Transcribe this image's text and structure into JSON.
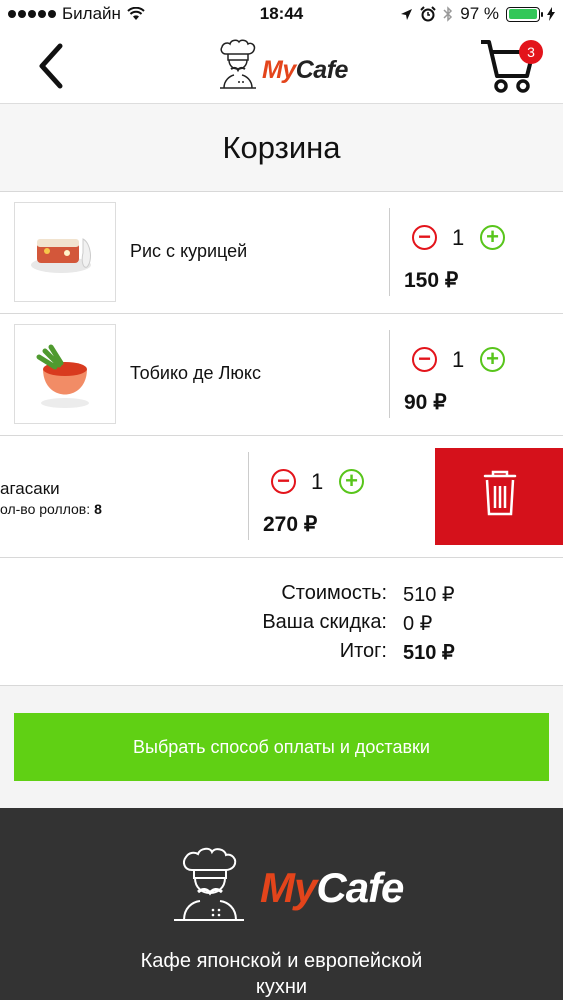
{
  "status_bar": {
    "carrier": "Билайн",
    "time": "18:44",
    "battery_percent": "97 %",
    "battery_level": 0.97
  },
  "header": {
    "logo_text": "MyCafe",
    "cart_count": "3"
  },
  "page_title": "Корзина",
  "cart_items": [
    {
      "name": "Рис с курицей",
      "quantity": "1",
      "price": "150 ₽"
    },
    {
      "name": "Тобико де Люкс",
      "quantity": "1",
      "price": "90 ₽"
    }
  ],
  "swiped_item": {
    "name": "Нагасаки",
    "visible_name": "агасаки",
    "meta_label": "ол-во роллов:",
    "meta_value": "8",
    "quantity": "1",
    "price": "270 ₽",
    "delete_icon": "trash-icon"
  },
  "totals": {
    "cost_label": "Стоимость:",
    "cost_value": "510 ₽",
    "discount_label": "Ваша скидка:",
    "discount_value": "0 ₽",
    "total_label": "Итог:",
    "total_value": "510 ₽"
  },
  "checkout_button": "Выбрать способ оплаты и доставки",
  "footer": {
    "logo_text": "MyCafe",
    "tagline_line1": "Кафе японской и европейской",
    "tagline_line2": "кухни"
  },
  "colors": {
    "brand_red": "#e3141b",
    "accent_green": "#60d014",
    "logo_orange": "#e3441b",
    "footer_bg": "#333333"
  }
}
